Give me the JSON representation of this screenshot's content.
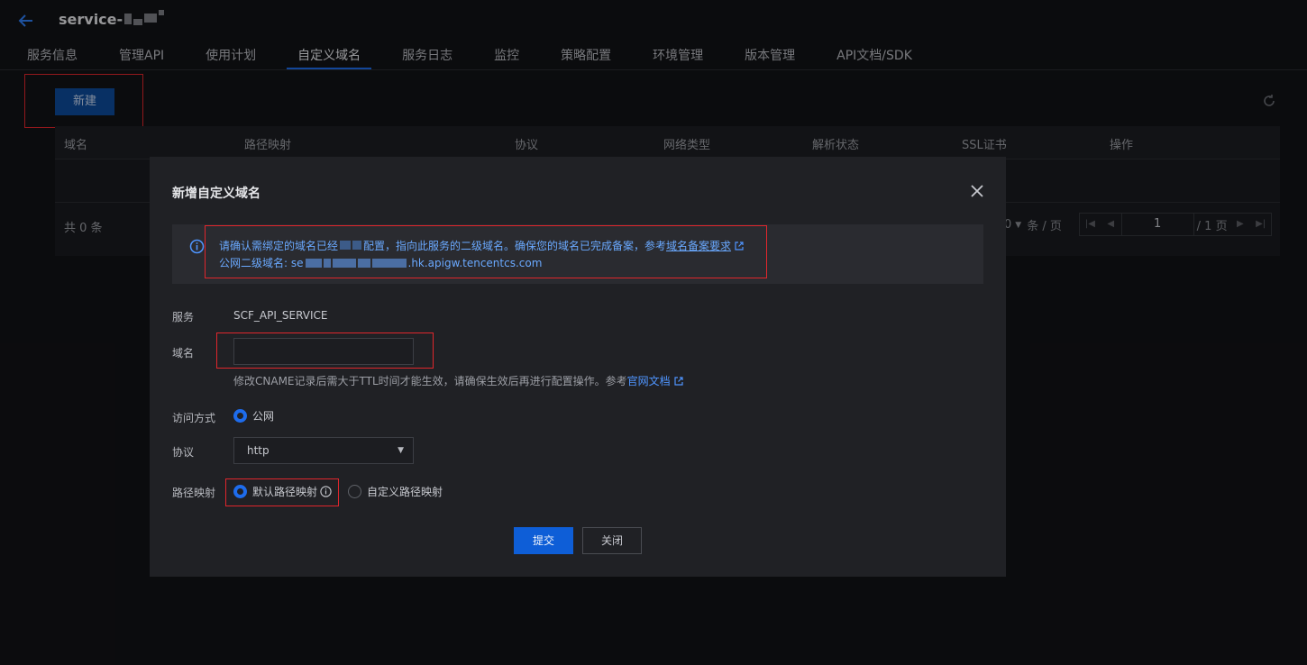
{
  "header": {
    "title_prefix": "service-"
  },
  "tabs": [
    {
      "label": "服务信息"
    },
    {
      "label": "管理API"
    },
    {
      "label": "使用计划"
    },
    {
      "label": "自定义域名"
    },
    {
      "label": "服务日志"
    },
    {
      "label": "监控"
    },
    {
      "label": "策略配置"
    },
    {
      "label": "环境管理"
    },
    {
      "label": "版本管理"
    },
    {
      "label": "API文档/SDK"
    }
  ],
  "active_tab": "自定义域名",
  "toolbar": {
    "new_label": "新建"
  },
  "table": {
    "columns": [
      "域名",
      "路径映射",
      "协议",
      "网络类型",
      "解析状态",
      "SSL证书",
      "操作"
    ],
    "total_text": "共 0 条"
  },
  "pagination": {
    "page_size_prefix": "0",
    "page_size_suffix": "条 / 页",
    "current_page": "1",
    "total_pages": "/ 1 页"
  },
  "modal": {
    "title": "新增自定义域名",
    "notice": {
      "line1_a": "请确认需绑定的域名已经",
      "line1_b": "配置，指向此服务的二级域名。确保您的域名已完成备案，参考",
      "line1_link": "域名备案要求",
      "line2_prefix": "公网二级域名: se",
      "line2_suffix": ".hk.apigw.tencentcs.com"
    },
    "form": {
      "service_label": "服务",
      "service_value": "SCF_API_SERVICE",
      "domain_label": "域名",
      "domain_value": "",
      "domain_hint": "修改CNAME记录后需大于TTL时间才能生效，请确保生效后再进行配置操作。参考",
      "domain_hint_link": "官网文档",
      "access_label": "访问方式",
      "access_option": "公网",
      "protocol_label": "协议",
      "protocol_value": "http",
      "path_label": "路径映射",
      "path_option_default": "默认路径映射",
      "path_option_custom": "自定义路径映射"
    },
    "submit_label": "提交",
    "close_label": "关闭"
  },
  "colors": {
    "accent": "#1e6cec",
    "annotation": "#e0262c",
    "background": "#121316",
    "modal_bg": "#202125"
  }
}
